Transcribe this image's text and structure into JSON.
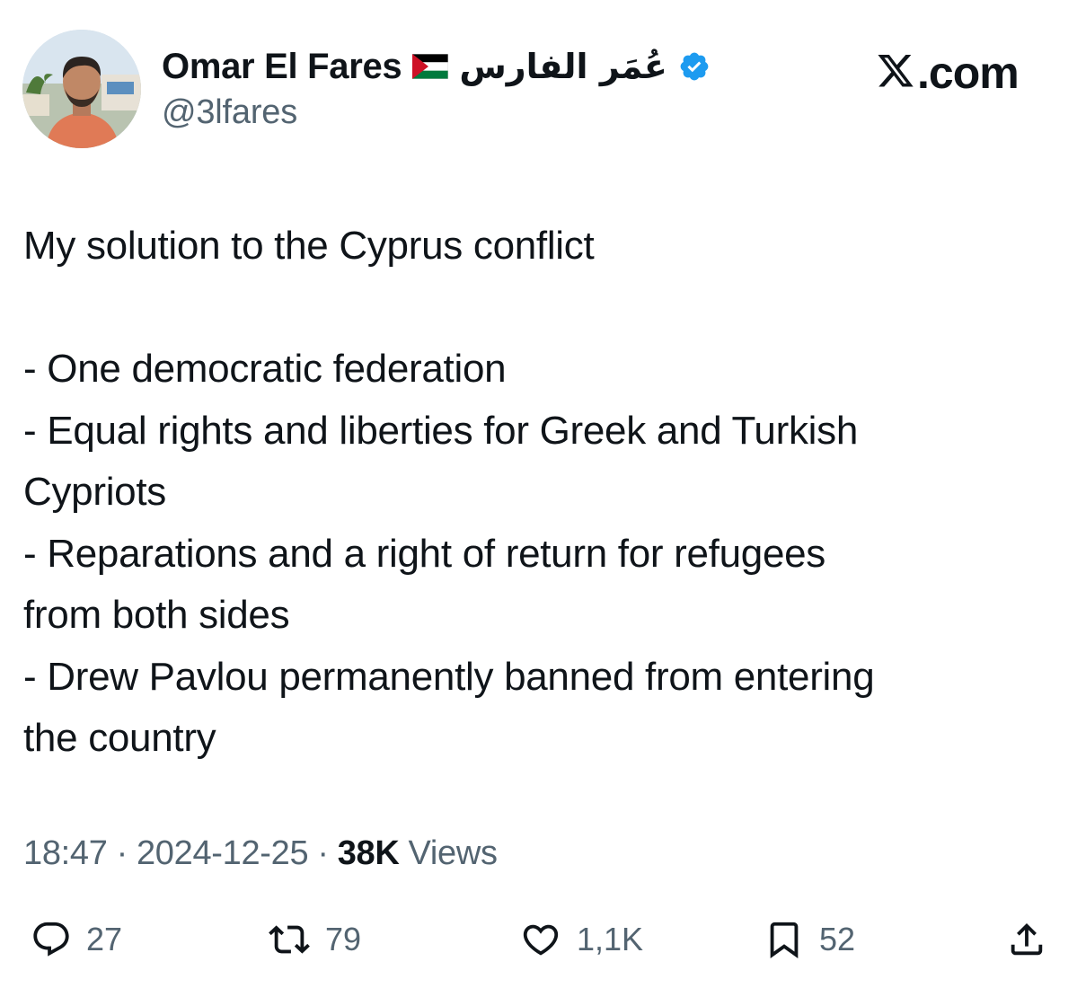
{
  "header": {
    "display_name": "Omar El Fares",
    "arabic_name": "عُمَر الفارس",
    "handle": "@3lfares",
    "brand_label": ".com",
    "icons": [
      "palestine-flag-icon",
      "verified-badge-icon",
      "x-logo-icon"
    ],
    "colors": {
      "verified": "#1d9bf0",
      "flag_red": "#ce1126",
      "flag_green": "#007a3d"
    }
  },
  "tweet": {
    "lines": [
      "My solution to the Cyprus conflict",
      "",
      "- One democratic federation",
      "- Equal rights and liberties for Greek and Turkish",
      "Cypriots",
      "- Reparations and a right of return for refugees",
      "from both sides",
      "- Drew Pavlou permanently banned from entering",
      "the country"
    ]
  },
  "meta": {
    "time": "18:47",
    "separator": "·",
    "date": "2024-12-25",
    "views_count": "38K",
    "views_label": "Views"
  },
  "actions": {
    "replies": "27",
    "retweets": "79",
    "likes": "1,1K",
    "bookmarks": "52",
    "icons": [
      "reply-icon",
      "retweet-icon",
      "like-icon",
      "bookmark-icon",
      "share-icon"
    ]
  }
}
